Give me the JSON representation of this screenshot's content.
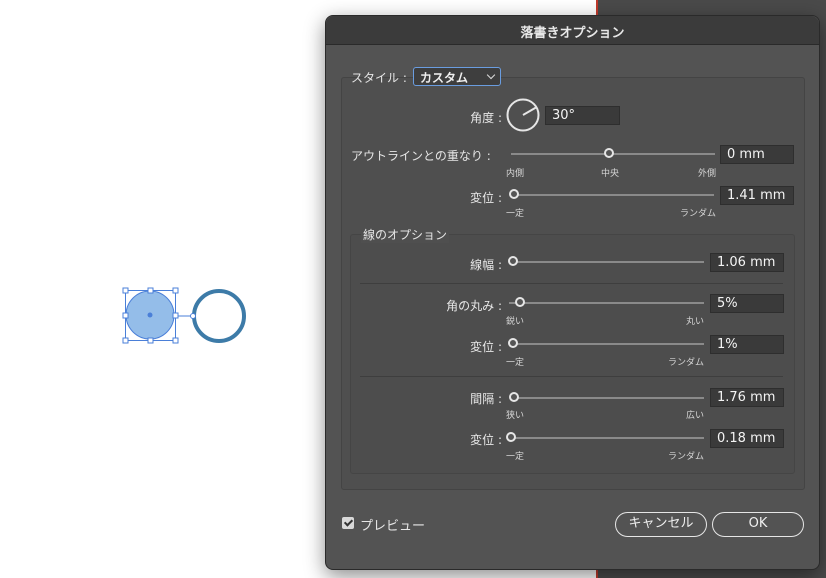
{
  "dialog": {
    "title": "落書きオプション",
    "style_label": "スタイル :",
    "style_value": "カスタム",
    "angle": {
      "label": "角度 :",
      "value": "30°"
    },
    "path_overlap": {
      "label": "アウトラインとの重なり :",
      "value": "0 mm",
      "min_label": "内側",
      "mid_label": "中央",
      "max_label": "外側"
    },
    "overlap_variation": {
      "label": "変位 :",
      "value": "1.41 mm",
      "min_label": "一定",
      "max_label": "ランダム"
    },
    "line_options": {
      "title": "線のオプション",
      "stroke_width": {
        "label": "線幅 :",
        "value": "1.06 mm"
      },
      "curviness": {
        "label": "角の丸み :",
        "value": "5%",
        "min_label": "鋭い",
        "max_label": "丸い"
      },
      "curviness_variation": {
        "label": "変位 :",
        "value": "1%",
        "min_label": "一定",
        "max_label": "ランダム"
      },
      "spacing": {
        "label": "間隔 :",
        "value": "1.76 mm",
        "min_label": "狭い",
        "max_label": "広い"
      },
      "spacing_variation": {
        "label": "変位 :",
        "value": "0.18 mm",
        "min_label": "一定",
        "max_label": "ランダム"
      }
    },
    "preview_label": "プレビュー",
    "cancel_label": "キャンセル",
    "ok_label": "OK"
  },
  "colors": {
    "selection_blue": "#4a7fd8",
    "artwork_stroke": "#3d7ba8",
    "dialog_bg": "#535353"
  }
}
